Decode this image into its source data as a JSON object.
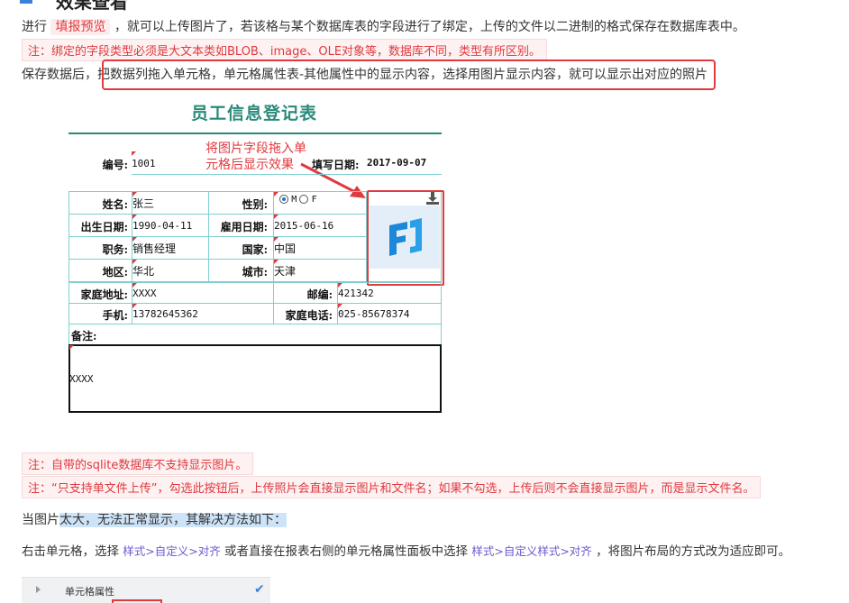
{
  "top_heading_partial": "效果查看",
  "para1": {
    "prefix": "进行",
    "tag": "填报预览",
    "suffix": "，就可以上传图片了，若该格与某个数据库表的字段进行了绑定，上传的文件以二进制的格式保存在数据库表中。"
  },
  "note1": "注：绑定的字段类型必须是大文本类如BLOB、image、OLE对象等，数据库不同，类型有所区别。",
  "para2": {
    "prefix": "保存数据后，把",
    "boxed": "数据列拖入单元格，单元格属性表-其他属性中的显示内容，选择用图片显示内容，就可以显示出对应的照片"
  },
  "form": {
    "title": "员工信息登记表",
    "annotation": "将图片字段拖入单元格后显示效果",
    "id_label": "编号:",
    "id_value": "1001",
    "date_label": "填写日期:",
    "date_value": "2017-09-07",
    "name_label": "姓名:",
    "name_value": "张三",
    "gender_label": "性别:",
    "gender_m": "M",
    "gender_f": "F",
    "birth_label": "出生日期:",
    "birth_value": "1990-04-11",
    "hire_label": "雇用日期:",
    "hire_value": "2015-06-16",
    "job_label": "职务:",
    "job_value": "销售经理",
    "country_label": "国家:",
    "country_value": "中国",
    "region_label": "地区:",
    "region_value": "华北",
    "city_label": "城市:",
    "city_value": "天津",
    "address_label": "家庭地址:",
    "address_value": "XXXX",
    "zip_label": "邮编:",
    "zip_value": "421342",
    "mobile_label": "手机:",
    "mobile_value": "13782645362",
    "phone_label": "家庭电话:",
    "phone_value": "025-85678374",
    "remark_label": "备注:",
    "remark_value": "XXXX"
  },
  "note2": "注：自带的sqlite数据库不支持显示图片。",
  "note3": "注：“只支持单文件上传”，勾选此按钮后，上传照片会直接显示图片和文件名；如果不勾选，上传后则不会直接显示图片，而是显示文件名。",
  "para3": {
    "prefix": "当图片",
    "highlighted": "太大，无法正常显示，其解决方法如下："
  },
  "para4": {
    "prefix": "右击单元格，选择",
    "path1": "样式>自定义>对齐",
    "middle": "或者直接在报表右侧的单元格属性面板中选择",
    "path2": "样式>自定义样式>对齐",
    "suffix": "，将图片布局的方式改为适应即可。"
  },
  "panel": {
    "title": "单元格属性"
  },
  "colors": {
    "accent_red": "#e0393e",
    "teal": "#2a8a7a",
    "link_purple": "#6a5acd",
    "highlight_blue": "#cde3f7"
  }
}
